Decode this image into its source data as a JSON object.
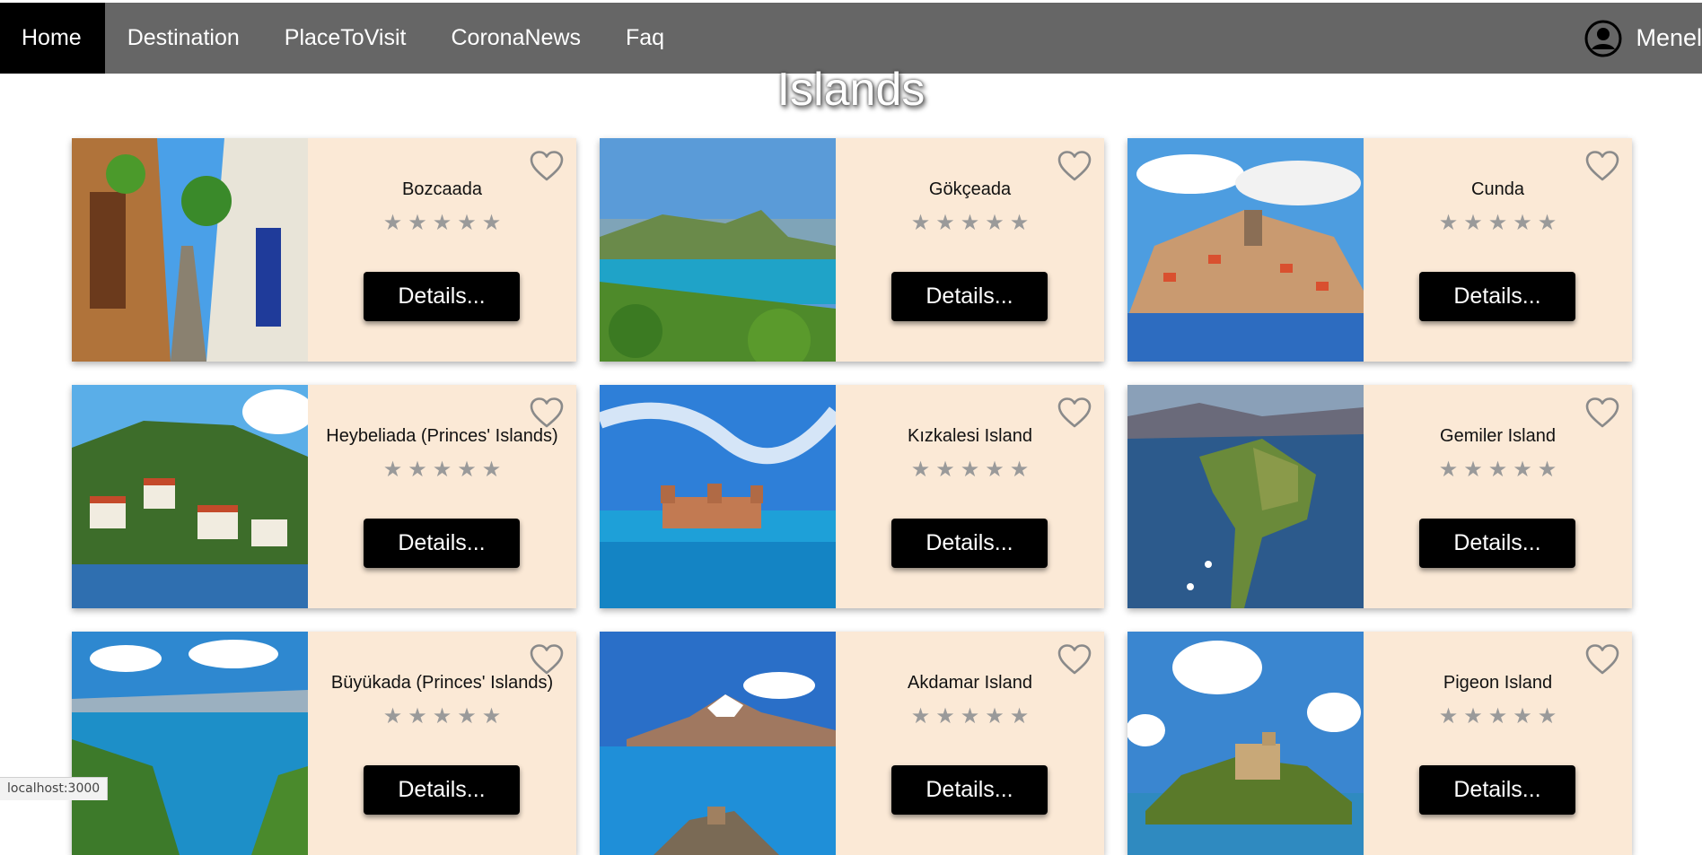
{
  "nav": {
    "items": [
      "Home",
      "Destination",
      "PlaceToVisit",
      "CoronaNews",
      "Faq"
    ],
    "active": "Home",
    "user_name": "Menel",
    "user_icon": "user-circle-icon"
  },
  "page": {
    "title": "Islands"
  },
  "cards": [
    {
      "title": "Bozcaada",
      "rating": 0,
      "button": "Details..."
    },
    {
      "title": "Gökçeada",
      "rating": 0,
      "button": "Details..."
    },
    {
      "title": "Cunda",
      "rating": 0,
      "button": "Details..."
    },
    {
      "title": "Heybeliada (Princes' Islands)",
      "rating": 0,
      "button": "Details..."
    },
    {
      "title": "Kızkalesi Island",
      "rating": 0,
      "button": "Details..."
    },
    {
      "title": "Gemiler Island",
      "rating": 0,
      "button": "Details..."
    },
    {
      "title": "Büyükada (Princes' Islands)",
      "rating": 0,
      "button": "Details..."
    },
    {
      "title": "Akdamar Island",
      "rating": 0,
      "button": "Details..."
    },
    {
      "title": "Pigeon Island",
      "rating": 0,
      "button": "Details..."
    }
  ],
  "status_bar": {
    "url": "localhost:3000"
  },
  "colors": {
    "navbar": "#666666",
    "nav_active": "#000000",
    "card_bg": "#fbe9d6",
    "button_bg": "#000000",
    "star": "#9a9a9a",
    "heart_outline": "#8a8a8a"
  }
}
